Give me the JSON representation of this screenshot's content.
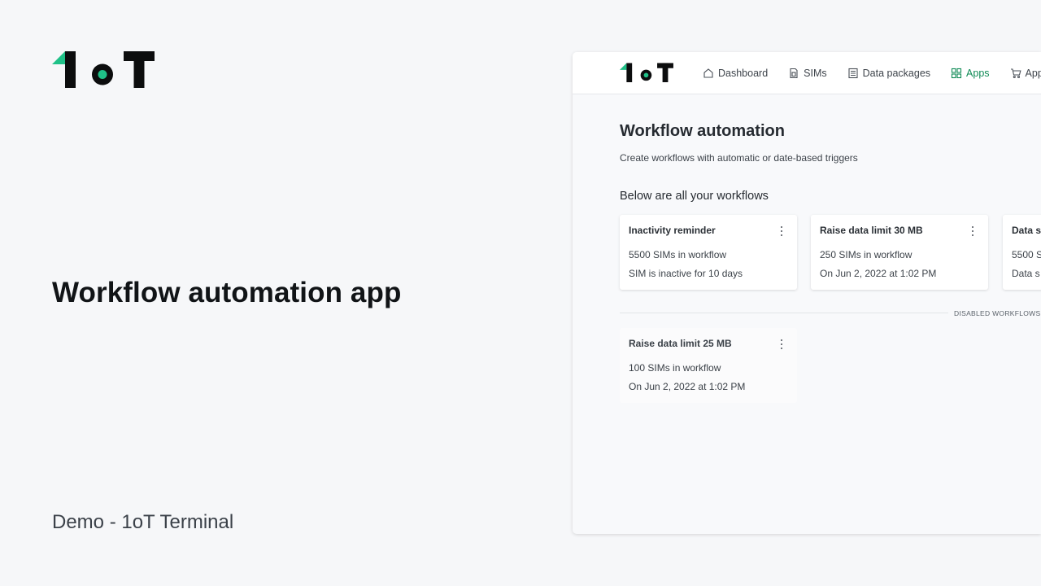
{
  "promo": {
    "logo_text": "1oT",
    "title": "Workflow automation app",
    "subtitle": "Demo - 1oT Terminal"
  },
  "brand": {
    "accent": "#1fc188",
    "dark": "#0c0d0e",
    "nav_active": "#0f8a55"
  },
  "nav": {
    "logo_text": "1oT",
    "items": [
      {
        "label": "Dashboard",
        "icon": "home-icon",
        "active": false
      },
      {
        "label": "SIMs",
        "icon": "sim-card-icon",
        "active": false
      },
      {
        "label": "Data packages",
        "icon": "document-icon",
        "active": false
      },
      {
        "label": "Apps",
        "icon": "apps-grid-icon",
        "active": true
      },
      {
        "label": "App s",
        "icon": "cart-icon",
        "active": false
      }
    ]
  },
  "page": {
    "title": "Workflow automation",
    "description": "Create workflows with automatic or date-based triggers",
    "section_heading": "Below are all your workflows",
    "disabled_label": "DISABLED WORKFLOWS"
  },
  "workflows": [
    {
      "title": "Inactivity reminder",
      "line1": "5500 SIMs in workflow",
      "line2": "SIM is inactive for 10 days"
    },
    {
      "title": "Raise data limit 30 MB",
      "line1": "250 SIMs in workflow",
      "line2": "On Jun 2, 2022 at 1:02 PM"
    },
    {
      "title": "Data s",
      "line1": "5500 S",
      "line2": "Data s"
    }
  ],
  "disabled_workflows": [
    {
      "title": "Raise data limit 25 MB",
      "line1": "100 SIMs in workflow",
      "line2": "On Jun 2, 2022 at 1:02 PM"
    }
  ]
}
